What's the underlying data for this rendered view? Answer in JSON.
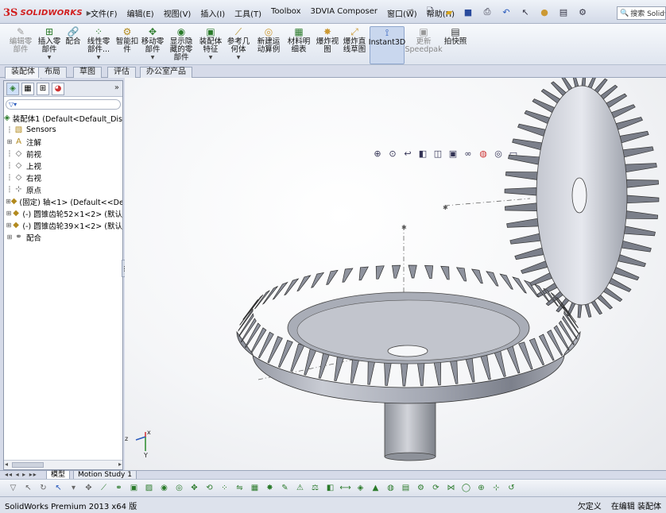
{
  "app": {
    "logo_prefix": "3S",
    "logo_name": "SOLIDWORKS",
    "menu": [
      "文件(F)",
      "编辑(E)",
      "视图(V)",
      "插入(I)",
      "工具(T)",
      "Toolbox",
      "3DVIA Composer",
      "窗口(W)",
      "帮助(H)"
    ],
    "search_placeholder": "搜索 Solidwork"
  },
  "commands": [
    {
      "label": "编辑零\n部件",
      "icon": "edit-component-icon",
      "grey": true
    },
    {
      "label": "插入零\n部件",
      "icon": "insert-component-icon",
      "grey": false,
      "dropdown": true
    },
    {
      "label": "配合",
      "icon": "mate-icon",
      "grey": false
    },
    {
      "label": "线性零\n部件...",
      "icon": "linear-pattern-icon",
      "grey": false,
      "dropdown": true
    },
    {
      "label": "智能扣\n件",
      "icon": "smart-fastener-icon",
      "grey": false
    },
    {
      "label": "移动零\n部件",
      "icon": "move-component-icon",
      "grey": false,
      "dropdown": true
    },
    {
      "label": "显示隐\n藏的零\n部件",
      "icon": "show-hidden-icon",
      "grey": false
    },
    {
      "label": "装配体\n特征",
      "icon": "assembly-feature-icon",
      "grey": false,
      "dropdown": true
    },
    {
      "label": "参考几\n何体",
      "icon": "reference-geometry-icon",
      "grey": false,
      "dropdown": true
    },
    {
      "label": "新建运\n动算例",
      "icon": "new-motion-study-icon",
      "grey": false
    },
    {
      "label": "材料明\n细表",
      "icon": "bom-icon",
      "grey": false
    },
    {
      "label": "爆炸视\n图",
      "icon": "exploded-view-icon",
      "grey": false
    },
    {
      "label": "爆炸直\n线草图",
      "icon": "explode-line-sketch-icon",
      "grey": false
    },
    {
      "label": "Instant3D",
      "icon": "instant3d-icon",
      "grey": false,
      "active": true
    },
    {
      "label": "更新\nSpeedpak",
      "icon": "speedpak-icon",
      "grey": true
    },
    {
      "label": "拍快照",
      "icon": "snapshot-icon",
      "grey": false
    }
  ],
  "tabs": [
    "装配体",
    "布局",
    "草图",
    "评估",
    "办公室产品"
  ],
  "tree": {
    "filter_icon": "filter-icon",
    "items": [
      {
        "label": "装配体1  (Default<Default_Dis",
        "icon": "assembly-icon",
        "exp": ""
      },
      {
        "label": "Sensors",
        "icon": "sensors-icon",
        "exp": ""
      },
      {
        "label": "注解",
        "icon": "annotations-icon",
        "exp": "+"
      },
      {
        "label": "前视",
        "icon": "plane-icon",
        "exp": ""
      },
      {
        "label": "上视",
        "icon": "plane-icon",
        "exp": ""
      },
      {
        "label": "右视",
        "icon": "plane-icon",
        "exp": ""
      },
      {
        "label": "原点",
        "icon": "origin-icon",
        "exp": ""
      },
      {
        "label": "(固定) 轴<1> (Default<<De",
        "icon": "part-icon",
        "exp": "+"
      },
      {
        "label": "(-) 圆锥齿轮52×1<2> (默认",
        "icon": "part-icon",
        "exp": "+"
      },
      {
        "label": "(-) 圆锥齿轮39×1<2> (默认",
        "icon": "part-icon",
        "exp": "+"
      },
      {
        "label": "配合",
        "icon": "mates-folder-icon",
        "exp": "+"
      }
    ]
  },
  "bottom_tabs": [
    "模型",
    "Motion Study 1"
  ],
  "status": {
    "product": "SolidWorks Premium 2013 x64 版",
    "state": "欠定义",
    "mode": "在编辑 装配体"
  }
}
